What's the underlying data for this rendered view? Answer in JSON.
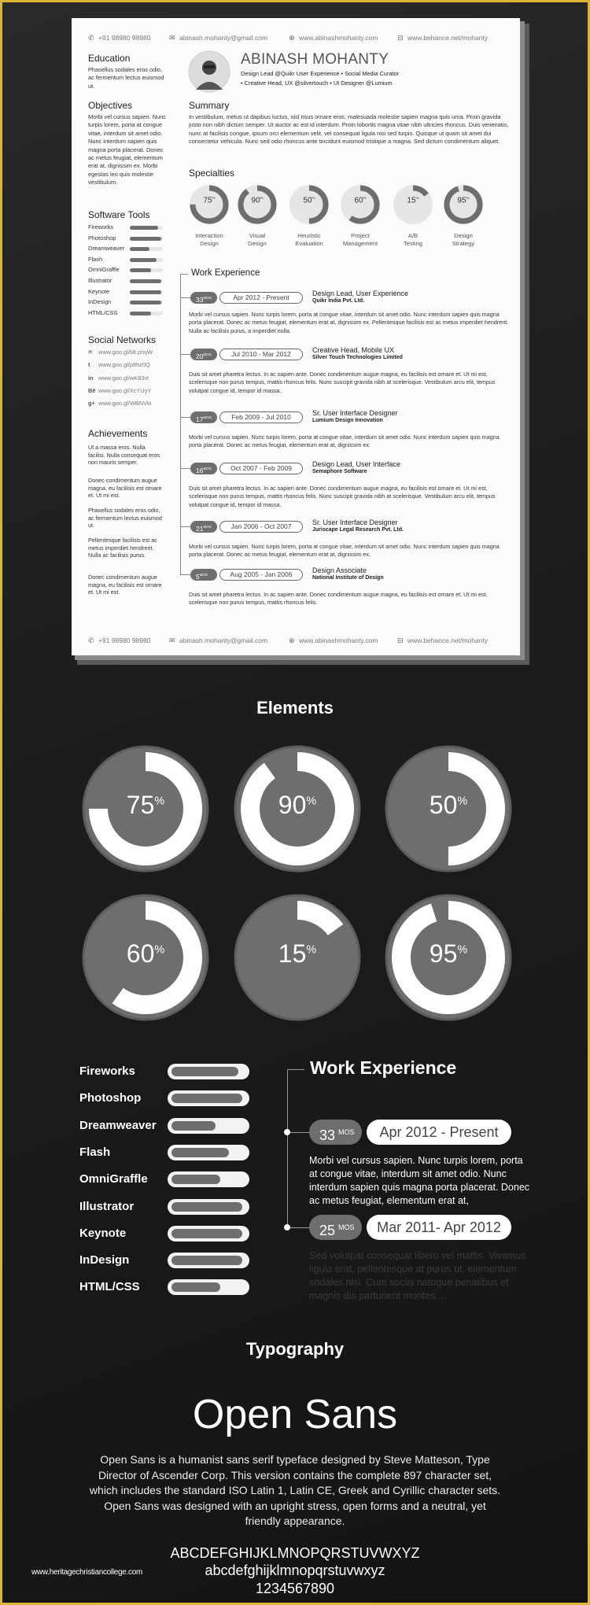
{
  "contact": {
    "phone": "+91 98980 98980",
    "email": "abinash.mohanty@gmail.com",
    "website": "www.abinashmohanty.com",
    "behance": "www.behance.net/mohanty"
  },
  "resume": {
    "name": "ABINASH MOHANTY",
    "subtitle1": "Design Lead @Quikr User Experience • Social Media Curator",
    "subtitle2": "• Creative Head, UX @silvertouch • UI Designer @Lumium",
    "education": {
      "heading": "Education",
      "text": "Phasellus sodales eros odio, ac fermentum lectus euismod ut."
    },
    "objectives": {
      "heading": "Objectives",
      "text": "Morbi vel cursus sapien. Nunc turpis lorem, porta at congue vitae, interdum sit amet odio. Nunc interdum sapien quis magna porta placerat. Donec ac metus feugiat, elementum erat at, dignissim ex. Morbi egestas leo quis molestie vestibulum."
    },
    "software": {
      "heading": "Software Tools",
      "items": [
        {
          "name": "Fireworks",
          "level": 0.85
        },
        {
          "name": "Photoshop",
          "level": 0.95
        },
        {
          "name": "Dreamweaver",
          "level": 0.6
        },
        {
          "name": "Flash",
          "level": 0.8
        },
        {
          "name": "OmniGraffle",
          "level": 0.65
        },
        {
          "name": "Illustrator",
          "level": 0.95
        },
        {
          "name": "Keynote",
          "level": 0.95
        },
        {
          "name": "InDesign",
          "level": 0.95
        },
        {
          "name": "HTML/CSS",
          "level": 0.65
        }
      ]
    },
    "social": {
      "heading": "Social Networks",
      "items": [
        {
          "icon": "pinterest-icon",
          "glyph": "℗",
          "url": "www.goo.gl/MLpmjW"
        },
        {
          "icon": "twitter-icon",
          "glyph": "t",
          "url": "www.goo.gl/p8hz0Q"
        },
        {
          "icon": "linkedin-icon",
          "glyph": "in",
          "url": "www.goo.gl/wK83vt"
        },
        {
          "icon": "behance-icon",
          "glyph": "Bē",
          "url": "www.goo.gl/XcYUyY"
        },
        {
          "icon": "google-plus-icon",
          "glyph": "g+",
          "url": "www.goo.gl/WBNVki"
        }
      ]
    },
    "achievements": {
      "heading": "Achievements",
      "items": [
        "Ut a massa eros. Nulla facilisi. Nulla consequat eros non mauris semper.",
        "Donec condimentum augue magna, eu facilisis est ornare et. Ut mi est.",
        "Phasellus sodales eros odio, ac fermentum lectus euismod ut.",
        "Pellentesque facilisis est ac metus imperdiet hendrerit. Nulla ac facilisis purus.",
        "Donec condimentum augue magna, eu facilisis est ornare et. Ut mi est."
      ]
    },
    "summary": {
      "heading": "Summary",
      "text": "In vestibulum, metus ut dapibus luctus, nisl risus ornare eros, malesuada molestie sapien magna quis urna. Proin gravida justo non nibh dictum semper. Ut auctor ac est id interdum. Proin lobortis magna vitae nibh ultricies rhoncus. Duis venenatis, nunc at facilisis congue, ipsum orci elementum velit, vel consequat ligula nisi sed turpis. Quisque ut quam sit amet dui consectetur vehicula. Nunc sed odio rhoncus ante tincidunt euismod tristique a magna. Sed dictum condimentum aliquet."
    },
    "specialties": {
      "heading": "Specialties",
      "items": [
        {
          "value": 75,
          "label1": "Interaction",
          "label2": "Design"
        },
        {
          "value": 90,
          "label1": "Visual",
          "label2": "Design"
        },
        {
          "value": 50,
          "label1": "Heuristic",
          "label2": "Evaluation"
        },
        {
          "value": 60,
          "label1": "Project",
          "label2": "Management"
        },
        {
          "value": 15,
          "label1": "A/B",
          "label2": "Testing"
        },
        {
          "value": 95,
          "label1": "Design",
          "label2": "Strategy"
        }
      ]
    },
    "work": {
      "heading": "Work Experience",
      "mos": "MOS",
      "items": [
        {
          "months": "33",
          "dates": "Apr 2012 - Present",
          "title": "Design Lead, User Experience",
          "company": "Quikr India Pvt. Ltd.",
          "desc": "Morbi vel cursus sapien. Nunc turpis lorem, porta at congue vitae, interdum sit amet odio. Nunc interdum sapien quis magna porta placerat. Donec ac metus feugiat, elementum erat at, dignissim ex. Pellentesque facilisis est ac metus imperdiet hendrerit. Nulla ac facilisis purus, a imperdiet nulla."
        },
        {
          "months": "20",
          "dates": "Jul 2010 - Mar 2012",
          "title": "Creative Head, Mobile UX",
          "company": "Silver Touch Technologies Limited",
          "desc": "Duis sit amet pharetra lectus. In ac sapien ante. Donec condimentum augue magna, eu facilisis est ornare et. Ut mi est, scelerisque non purus tempus, mattis rhoncus felis. Nunc suscipit gravida nibh at scelerisque. Vestibulum arcu elit, tempus volutpat congue id, tempor id massa."
        },
        {
          "months": "17",
          "dates": "Feb 2009 - Jul 2010",
          "title": "Sr. User Interface Designer",
          "company": "Lumium Design Innovation",
          "desc": "Morbi vel cursus sapien. Nunc turpis lorem, porta at congue vitae, interdum sit amet odio. Nunc interdum sapien quis magna porta placerat. Donec ac metus feugiat, elementum erat at, dignissim ex."
        },
        {
          "months": "16",
          "dates": "Oct 2007 - Feb 2009",
          "title": "Design Lead, User Interface",
          "company": "Semaphore Software",
          "desc": "Duis sit amet pharetra lectus. In ac sapien ante. Donec condimentum augue magna, eu facilisis est ornare et. Ut mi est, scelerisque non purus tempus, mattis rhoncus felis. Nunc suscipit gravida nibh at scelerisque. Vestibulum arcu elit, tempus volutpat congue id, tempor id massa."
        },
        {
          "months": "21",
          "dates": "Jan 2006 - Oct 2007",
          "title": "Sr. User Interface Designer",
          "company": "Juriscape Legal Research Pvt. Ltd.",
          "desc": "Morbi vel cursus sapien. Nunc turpis lorem, porta at congue vitae, interdum sit amet odio. Nunc interdum sapien quis magna porta placerat. Donec ac metus feugiat, elementum erat at, dignissim ex."
        },
        {
          "months": "5",
          "dates": "Aug 2005 - Jan 2006",
          "title": "Design Associate",
          "company": "National Institute of Design",
          "desc": "Duis sit amet pharetra lectus. In ac sapien ante. Donec condimentum augue magna, eu facilisis est ornare et. Ut mi est, scelerisque non purus tempus, mattis rhoncus felis."
        }
      ]
    }
  },
  "elements": {
    "heading": "Elements",
    "donuts": [
      75,
      90,
      50,
      60,
      15,
      95
    ],
    "percent": "%"
  },
  "dark_skills": [
    {
      "name": "Fireworks",
      "level": 0.9
    },
    {
      "name": "Photoshop",
      "level": 0.96
    },
    {
      "name": "Dreamweaver",
      "level": 0.6
    },
    {
      "name": "Flash",
      "level": 0.78
    },
    {
      "name": "OmniGraffle",
      "level": 0.66
    },
    {
      "name": "Illustrator",
      "level": 0.96
    },
    {
      "name": "Keynote",
      "level": 0.96
    },
    {
      "name": "InDesign",
      "level": 0.96
    },
    {
      "name": "HTML/CSS",
      "level": 0.66
    }
  ],
  "dark_work": {
    "heading": "Work Experience",
    "mos": "MOS",
    "items": [
      {
        "months": "33",
        "dates": "Apr 2012 - Present",
        "desc": "Morbi vel cursus sapien. Nunc turpis lorem, porta at congue vitae, interdum sit amet odio. Nunc interdum sapien quis magna porta placerat. Donec ac metus feugiat, elementum erat at,"
      },
      {
        "months": "25",
        "dates": "Mar 2011- Apr 2012",
        "desc": "Sed volutpat consequat libero vel mattis. Vivamus ligula erat, pellentesque at purus ut, elementum sodales nisi. Cum sociis natoque penatibus et magnis dis parturient montes...."
      }
    ]
  },
  "typography": {
    "heading": "Typography",
    "font_name": "Open Sans",
    "desc": "Open Sans is a humanist sans serif typeface designed by Steve Matteson, Type Director of Ascender Corp. This version contains the complete 897 character set, which includes the standard ISO Latin 1, Latin CE, Greek and Cyrillic character sets. Open Sans was designed with an upright stress, open forms and a neutral, yet friendly appearance.",
    "upper": "ABCDEFGHIJKLMNOPQRSTUVWXYZ",
    "lower": "abcdefghijklmnopqrstuvwxyz",
    "digits": "1234567890"
  },
  "watermark": "www.heritagechristiancollege.com",
  "colors": {
    "accent_grey": "#6d6e70",
    "paper": "#fbfbfb",
    "frame": "#d8b63a",
    "background": "#1b1b1b"
  }
}
